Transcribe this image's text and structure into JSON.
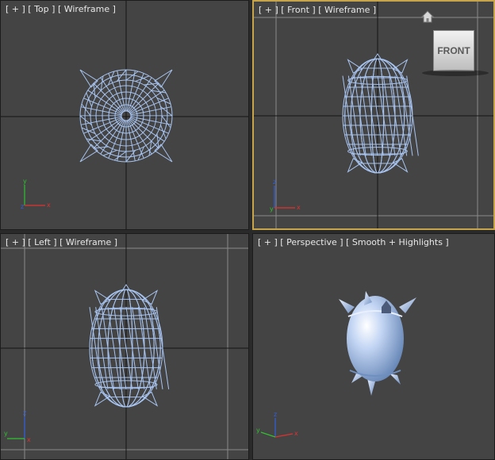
{
  "viewports": {
    "top": {
      "plus": "[ + ]",
      "name": "[ Top ]",
      "mode": "[ Wireframe ]"
    },
    "front": {
      "plus": "[ + ]",
      "name": "[ Front ]",
      "mode": "[ Wireframe ]"
    },
    "left": {
      "plus": "[ + ]",
      "name": "[ Left ]",
      "mode": "[ Wireframe ]"
    },
    "persp": {
      "plus": "[ + ]",
      "name": "[ Perspective ]",
      "mode": "[ Smooth + Highlights ]"
    }
  },
  "viewcube": {
    "face": "FRONT"
  },
  "axes": {
    "top": {
      "up": "y",
      "right": "x",
      "origin": "z"
    },
    "front": {
      "up": "z",
      "right": "x",
      "origin": "y"
    },
    "left": {
      "up": "z",
      "right": "y",
      "origin": "x"
    },
    "persp": {
      "up": "z",
      "right": "x",
      "origin": "y"
    }
  },
  "colors": {
    "viewport_bg": "#444444",
    "active_border": "#c7a34a",
    "wireframe": "#a8c4f0",
    "axis_x": "#e03030",
    "axis_y": "#30c030",
    "axis_z": "#3060e0"
  },
  "icons": {
    "home": "home-icon"
  }
}
